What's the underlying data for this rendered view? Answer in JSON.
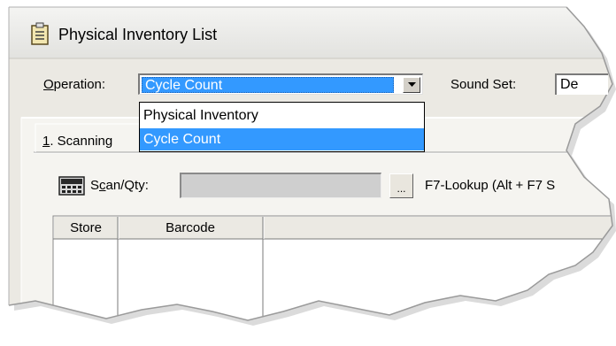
{
  "window": {
    "title": "Physical Inventory List"
  },
  "operation": {
    "label_prefix": "",
    "label_mnemonic": "O",
    "label_rest": "peration:",
    "selected": "Cycle Count",
    "options": [
      "Physical Inventory",
      "Cycle Count"
    ]
  },
  "sound_set": {
    "label": "Sound Set:",
    "value": "De"
  },
  "tab": {
    "mnemonic": "1",
    "rest": ". Scanning"
  },
  "scan": {
    "label_first": "S",
    "label_mnemonic": "c",
    "label_rest": "an/Qty:",
    "value": "",
    "lookup_button": "...",
    "lookup_hint": "F7-Lookup  (Alt + F7 S"
  },
  "table": {
    "columns": [
      "Store",
      "Barcode"
    ]
  },
  "colors": {
    "selection": "#3399ff",
    "input_disabled": "#cfcfcf",
    "window_bg": "#ebe9e3"
  }
}
